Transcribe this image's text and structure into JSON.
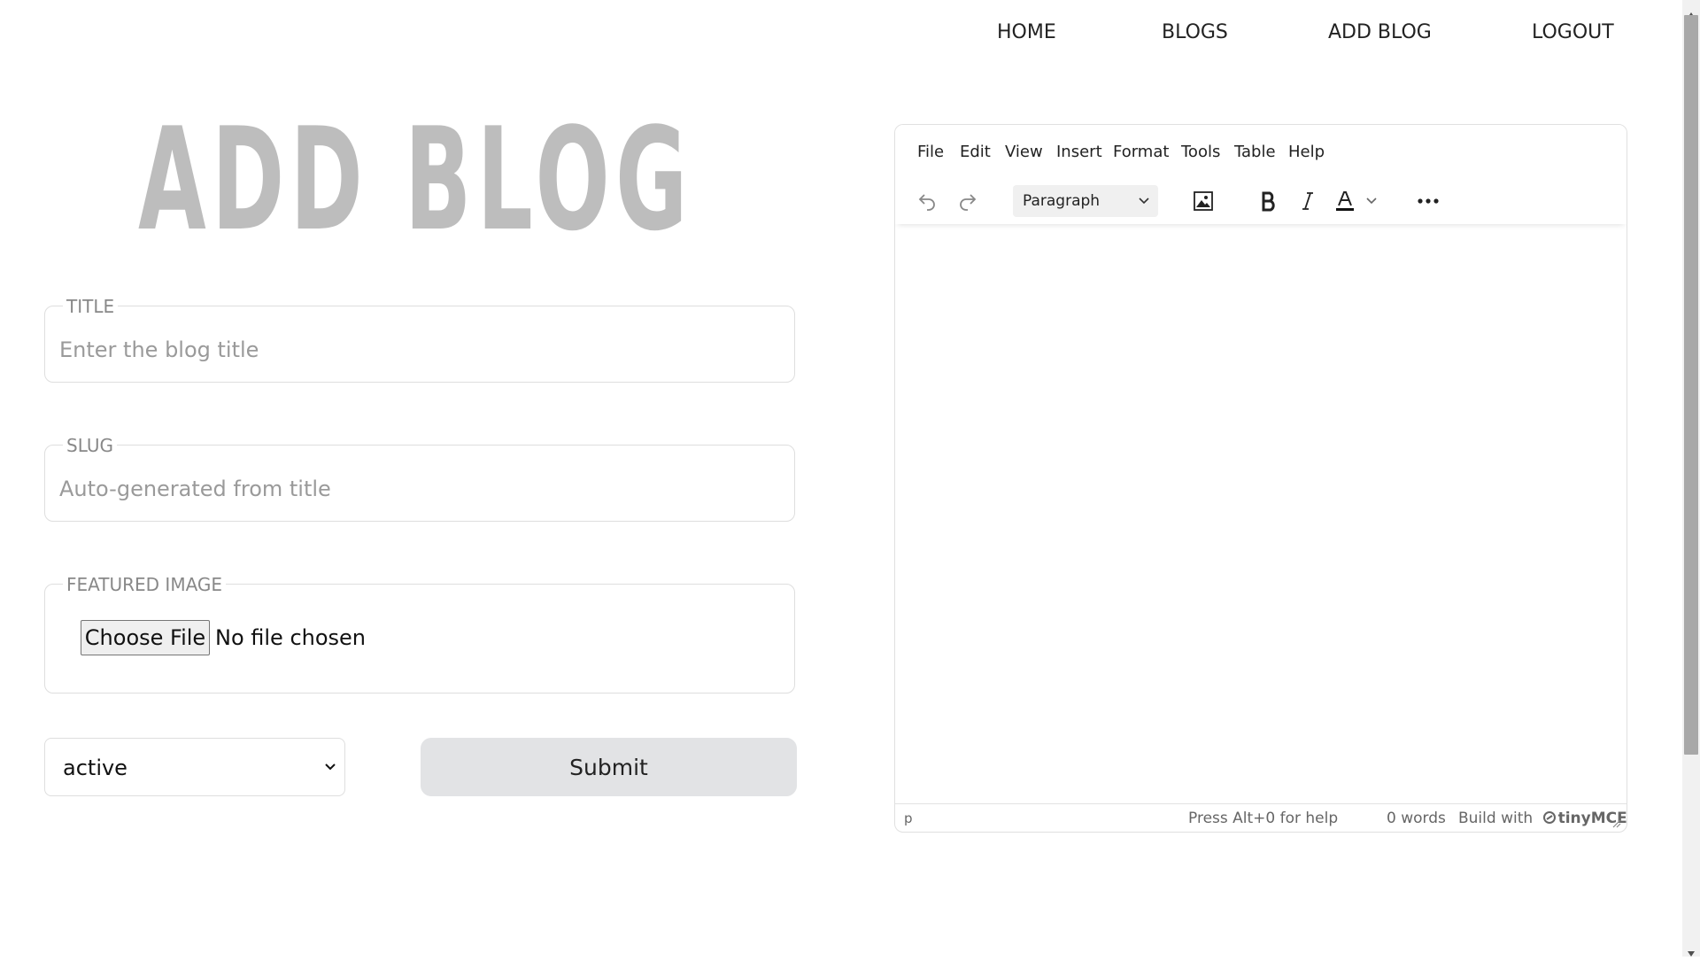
{
  "nav": {
    "home": "HOME",
    "blogs": "BLOGS",
    "add_blog": "ADD BLOG",
    "logout": "LOGOUT"
  },
  "page_title": "ADD BLOG",
  "form": {
    "title": {
      "legend": "TITLE",
      "placeholder": "Enter the blog title",
      "value": ""
    },
    "slug": {
      "legend": "SLUG",
      "placeholder": "Auto-generated from title",
      "value": ""
    },
    "featured_image": {
      "legend": "FEATURED IMAGE",
      "button_label": "Choose File",
      "status": "No file chosen"
    },
    "status": {
      "selected": "active",
      "icon": "chevron-down-icon"
    },
    "submit_label": "Submit"
  },
  "editor": {
    "menu": [
      "File",
      "Edit",
      "View",
      "Insert",
      "Format",
      "Tools",
      "Table",
      "Help"
    ],
    "toolbar": {
      "block_format": "Paragraph",
      "icons": [
        "undo-icon",
        "redo-icon",
        "chevron-down-icon",
        "image-icon",
        "bold-icon",
        "italic-icon",
        "text-color-icon",
        "chevron-down-icon",
        "more-icon"
      ]
    },
    "statusbar": {
      "path": "p",
      "help": "Press Alt+0 for help",
      "word_count": "0 words",
      "branding_prefix": "Build with",
      "branding_name": "tinyMCE"
    }
  },
  "colors": {
    "title_gray": "#bdbdbd",
    "submit_bg": "#e2e3e5",
    "border": "#dedede",
    "scrollbar_thumb": "#a8a8a8"
  }
}
